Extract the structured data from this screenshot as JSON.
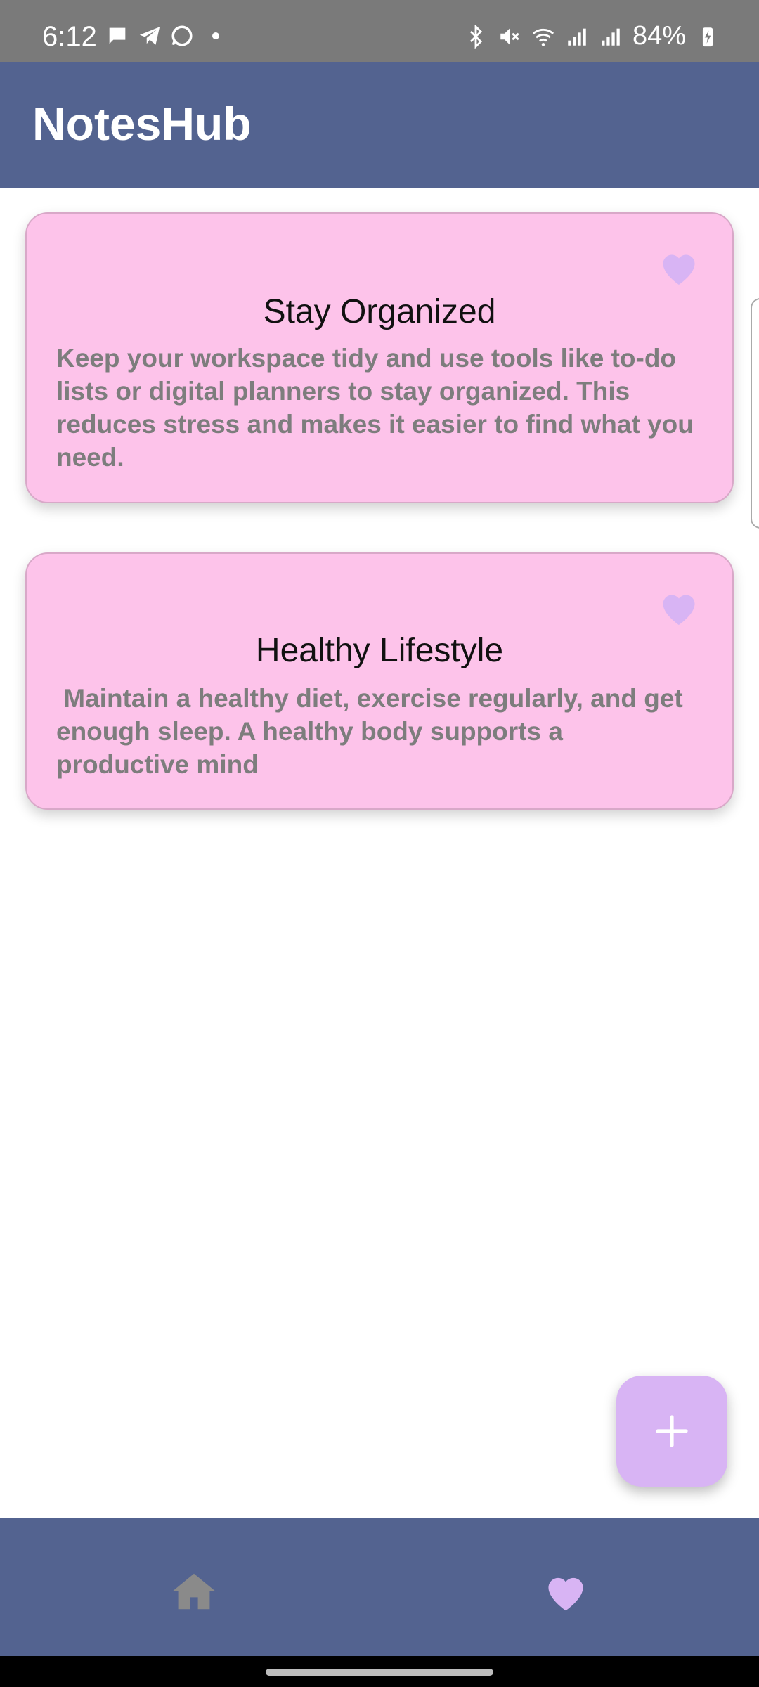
{
  "status_bar": {
    "time": "6:12",
    "battery": "84%",
    "icons": [
      "message-icon",
      "telegram-icon",
      "whatsapp-icon",
      "bluetooth-icon",
      "mute-icon",
      "wifi-icon",
      "signal-lte1-icon",
      "signal-lte2-icon",
      "battery-charging-icon"
    ]
  },
  "app": {
    "title": "NotesHub"
  },
  "notes": [
    {
      "title": "Stay Organized",
      "body": "Keep your workspace tidy and use tools like to-do lists or digital planners to stay organized. This reduces stress and makes it easier to find what you need."
    },
    {
      "title": "Healthy Lifestyle",
      "body": " Maintain a healthy diet, exercise regularly, and get enough sleep. A healthy body supports a productive mind"
    }
  ],
  "fab": {
    "icon": "plus-icon"
  },
  "bottom_nav": {
    "items": [
      {
        "icon": "home-icon",
        "selected": false
      },
      {
        "icon": "heart-icon",
        "selected": true
      }
    ]
  },
  "colors": {
    "app_bar": "#536390",
    "card": "#fdc3ea",
    "accent": "#d8b4f4"
  }
}
